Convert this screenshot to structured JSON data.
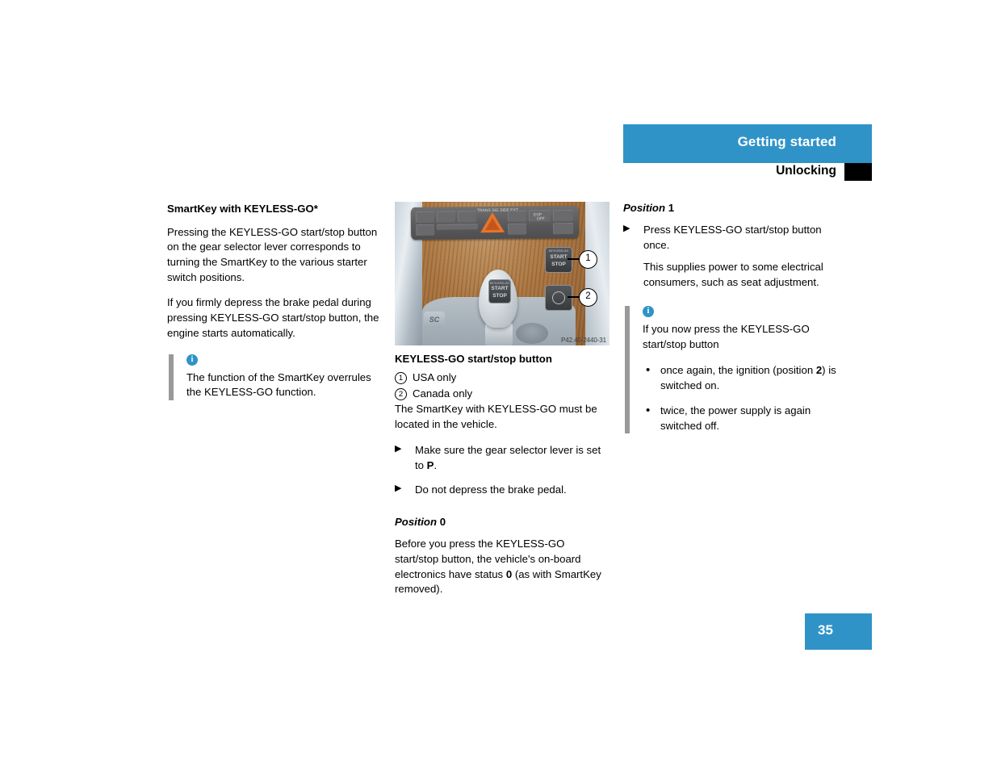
{
  "header": {
    "title": "Getting started",
    "subtitle": "Unlocking"
  },
  "page_number": "35",
  "left_column": {
    "section_title": "SmartKey with KEYLESS-GO*",
    "paragraph_1": "Pressing the KEYLESS-GO start/stop button on the gear selector lever corresponds to turning the SmartKey to the various starter switch positions.",
    "paragraph_2": "If you firmly depress the brake pedal during pressing KEYLESS-GO start/stop button, the engine starts automatically.",
    "info_box": {
      "icon": "info-icon",
      "icon_char": "i",
      "text": "The function of the SmartKey overrules the KEYLESS-GO function."
    }
  },
  "middle_column": {
    "figure": {
      "reference_code": "P42.45-2440-31",
      "callout_1": "1",
      "callout_2": "2",
      "lever_button_label_top": "KEYLESS-GO",
      "lever_button_label_mid": "START",
      "lever_button_label_bot": "STOP",
      "console_button_label_top": "KEYLESS-GO",
      "console_button_label_mid": "START",
      "console_button_label_bot": "STOP",
      "esp_label": "ESP",
      "esp_sub": "OFF",
      "warning_label": "TRANS SIG SIDE EXT",
      "sc_label": "SC"
    },
    "figure_caption": "KEYLESS-GO start/stop button",
    "legend": [
      {
        "num": "1",
        "text": "USA only"
      },
      {
        "num": "2",
        "text": "Canada only"
      }
    ],
    "paragraph_after_legend": "The SmartKey with KEYLESS-GO must be located in the vehicle.",
    "steps": [
      {
        "marker": "▶",
        "text_before": "Make sure the gear selector lever is set to ",
        "bold": "P",
        "text_after": "."
      },
      {
        "marker": "▶",
        "text_before": "Do not depress the brake pedal.",
        "bold": "",
        "text_after": ""
      }
    ],
    "position_0": {
      "heading_word": "Position",
      "heading_num": "0",
      "text_before": "Before you press the KEYLESS-GO start/stop button, the vehicle's on-board electronics have status ",
      "bold": "0",
      "text_after": " (as with SmartKey removed)."
    }
  },
  "right_column": {
    "position_1": {
      "heading_word": "Position",
      "heading_num": "1"
    },
    "step": {
      "marker": "▶",
      "text": "Press KEYLESS-GO start/stop button once."
    },
    "step_note": "This supplies power to some electrical consumers, such as seat adjustment.",
    "info_box": {
      "icon": "info-icon",
      "icon_char": "i",
      "intro": "If you now press the KEYLESS-GO start/stop button",
      "bullets": [
        {
          "marker": "•",
          "text_before": "once again, the ignition (position ",
          "bold": "2",
          "text_after": ") is switched on."
        },
        {
          "marker": "•",
          "text_before": "twice, the power supply is again switched off.",
          "bold": "",
          "text_after": ""
        }
      ]
    }
  },
  "colors": {
    "accent_blue": "#2f93c8",
    "black_block": "#000000",
    "info_bar_gray": "#999999"
  }
}
